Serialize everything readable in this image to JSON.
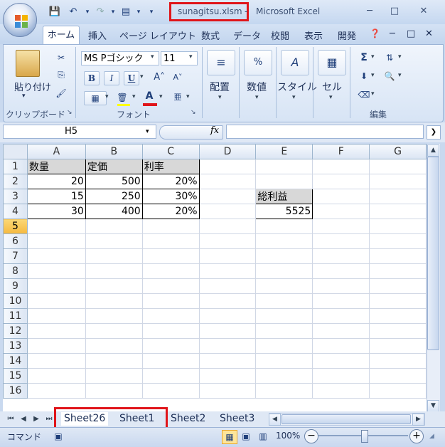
{
  "title": {
    "filename": "sunagitsu.xlsm",
    "separator": "-",
    "app": "Microsoft Excel"
  },
  "ribbon_tabs": [
    "ホーム",
    "挿入",
    "ページ レイアウト",
    "数式",
    "データ",
    "校閲",
    "表示",
    "開発"
  ],
  "clipboard": {
    "paste_label": "貼り付け",
    "group_label": "クリップボード"
  },
  "font": {
    "name": "MS Pゴシック",
    "size": "11",
    "bold": "B",
    "italic": "I",
    "underline": "U",
    "group_label": "フォント",
    "color_icon": "A"
  },
  "groups": {
    "alignment": "配置",
    "number": "数値",
    "style": "スタイル",
    "cells": "セル",
    "editing": "編集"
  },
  "name_box": "H5",
  "fx": "fx",
  "columns": [
    "A",
    "B",
    "C",
    "D",
    "E",
    "F",
    "G"
  ],
  "rows": [
    "1",
    "2",
    "3",
    "4",
    "5",
    "6",
    "7",
    "8",
    "9",
    "10",
    "11",
    "12",
    "13",
    "14",
    "15",
    "16"
  ],
  "cells": {
    "A1": "数量",
    "B1": "定価",
    "C1": "利率",
    "A2": "20",
    "B2": "500",
    "C2": "20%",
    "A3": "15",
    "B3": "250",
    "C3": "30%",
    "E3": "総利益",
    "A4": "30",
    "B4": "400",
    "C4": "20%",
    "E4": "5525"
  },
  "sheet_tabs": [
    "Sheet26",
    "Sheet1",
    "Sheet2",
    "Sheet3"
  ],
  "status": {
    "mode": "コマンド",
    "zoom": "100%"
  }
}
